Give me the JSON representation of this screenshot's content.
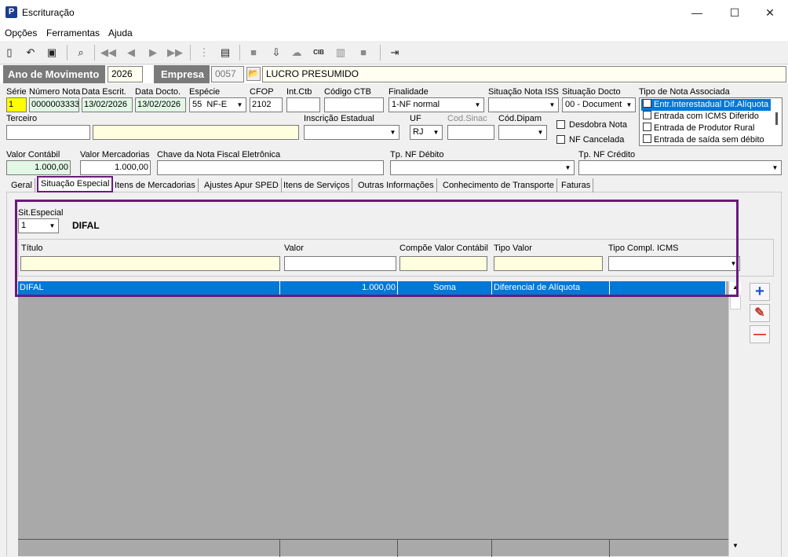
{
  "window": {
    "title": "Escrituração",
    "app_icon": "P",
    "minimize": "—",
    "maximize": "☐",
    "close": "✕"
  },
  "menu": [
    "Opções",
    "Ferramentas",
    "Ajuda"
  ],
  "toolbar_icons": [
    "new-icon",
    "undo-icon",
    "save-icon",
    "preview-icon",
    "first-icon",
    "prev-icon",
    "next-icon",
    "last-icon",
    "tree-icon",
    "calc-icon",
    "report-icon",
    "download-icon",
    "cloud-icon",
    "cib-icon",
    "grid-icon",
    "square-icon",
    "exit-icon"
  ],
  "header": {
    "ano_label": "Ano de Movimento",
    "ano_value": "2026",
    "empresa_label": "Empresa",
    "empresa_code": "0057",
    "empresa_name": "LUCRO PRESUMIDO"
  },
  "fields": {
    "serie": {
      "label": "Série",
      "value": "1"
    },
    "numero": {
      "label": "Número Nota",
      "value": "0000003333"
    },
    "data_escrit": {
      "label": "Data Escrit.",
      "value": "13/02/2026"
    },
    "data_docto": {
      "label": "Data Docto.",
      "value": "13/02/2026"
    },
    "especie": {
      "label": "Espécie",
      "code": "55",
      "value": "NF-E"
    },
    "cfop": {
      "label": "CFOP",
      "value": "2102"
    },
    "int_ctb": {
      "label": "Int.Ctb",
      "value": ""
    },
    "codigo_ctb": {
      "label": "Código CTB",
      "value": ""
    },
    "finalidade": {
      "label": "Finalidade",
      "value": "1-NF normal"
    },
    "sit_iss": {
      "label": "Situação Nota ISS",
      "value": ""
    },
    "sit_docto": {
      "label": "Situação Docto",
      "value": "00 - Document"
    },
    "tipo_nota": {
      "label": "Tipo de Nota Associada",
      "items": [
        "Entr.Interestadual Dif.Alíquota",
        "Entrada com ICMS Diferido",
        "Entrada de Produtor Rural",
        "Entrada de saída sem débito"
      ]
    },
    "terceiro": {
      "label": "Terceiro",
      "value": ""
    },
    "insc_estadual": {
      "label": "Inscrição Estadual",
      "value": ""
    },
    "uf": {
      "label": "UF",
      "value": "RJ"
    },
    "cod_sinac": {
      "label": "Cod.Sinac",
      "value": ""
    },
    "cod_dipam": {
      "label": "Cód.Dipam",
      "value": ""
    },
    "desdobra": {
      "label": "Desdobra Nota"
    },
    "nf_cancelada": {
      "label": "NF Cancelada"
    },
    "valor_contabil": {
      "label": "Valor Contábil",
      "value": "1.000,00"
    },
    "valor_merc": {
      "label": "Valor Mercadorias",
      "value": "1.000,00"
    },
    "chave": {
      "label": "Chave da Nota Fiscal Eletrônica",
      "value": ""
    },
    "tp_debito": {
      "label": "Tp. NF Débito",
      "value": ""
    },
    "tp_credito": {
      "label": "Tp. NF Crédito",
      "value": ""
    }
  },
  "tabs": [
    "Geral",
    "Situação Especial",
    "Itens de Mercadorias",
    "Ajustes Apur SPED",
    "Itens de Serviços",
    "Outras Informações",
    "Conhecimento de Transporte",
    "Faturas"
  ],
  "sit_especial": {
    "label": "Sit.Especial",
    "value": "1",
    "name": "DIFAL"
  },
  "grid_headers": [
    "Título",
    "Valor",
    "Compõe Valor Contábil",
    "Tipo Valor",
    "Tipo Compl. ICMS"
  ],
  "grid_row": {
    "titulo": "DIFAL",
    "valor": "1.000,00",
    "compoe": "Soma",
    "tipo_valor": "Diferencial de Alíquota",
    "tipo_compl": ""
  },
  "side_buttons": {
    "add": "+",
    "edit": "✎",
    "remove": "—"
  }
}
